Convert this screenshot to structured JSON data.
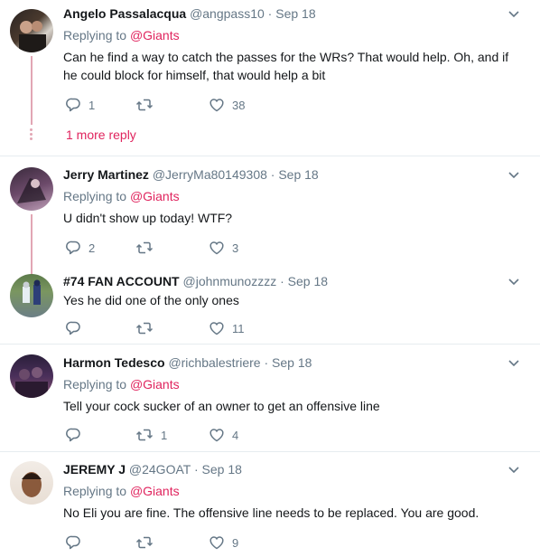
{
  "tweets": [
    {
      "name": "Angelo Passalacqua",
      "handle": "@angpass10",
      "sep": "·",
      "date": "Sep 18",
      "replying_prefix": "Replying to",
      "replying_to": "@Giants",
      "text": "Can he find a way to catch the passes for the WRs?  That would help.  Oh, and if he could block for himself, that would help a bit",
      "replies": "1",
      "retweets": "",
      "likes": "38"
    },
    {
      "name": "Jerry Martinez",
      "handle": "@JerryMa80149308",
      "sep": "·",
      "date": "Sep 18",
      "replying_prefix": "Replying to",
      "replying_to": "@Giants",
      "text": "U didn't show up today! WTF?",
      "replies": "2",
      "retweets": "",
      "likes": "3"
    },
    {
      "name": "#74 FAN ACCOUNT",
      "handle": "@johnmunozzzz",
      "sep": "·",
      "date": "Sep 18",
      "text": "Yes he did one of the only ones",
      "replies": "",
      "retweets": "",
      "likes": "11"
    },
    {
      "name": "Harmon Tedesco",
      "handle": "@richbalestriere",
      "sep": "·",
      "date": "Sep 18",
      "replying_prefix": "Replying to",
      "replying_to": "@Giants",
      "text": "Tell your cock sucker of an owner to get an offensive line",
      "replies": "",
      "retweets": "1",
      "likes": "4"
    },
    {
      "name": "JEREMY J",
      "handle": "@24GOAT",
      "sep": "·",
      "date": "Sep 18",
      "replying_prefix": "Replying to",
      "replying_to": "@Giants",
      "text": "No Eli you are fine. The offensive line needs to be replaced. You are good.",
      "replies": "",
      "retweets": "",
      "likes": "9"
    }
  ],
  "more_replies_label": "1 more reply",
  "icons": {
    "reply": "reply-icon",
    "retweet": "retweet-icon",
    "like": "heart-icon",
    "menu": "chevron-down-icon"
  },
  "colors": {
    "accent": "#e0245e",
    "secondary_text": "#657786",
    "thread_line": "#e2a6b4"
  }
}
